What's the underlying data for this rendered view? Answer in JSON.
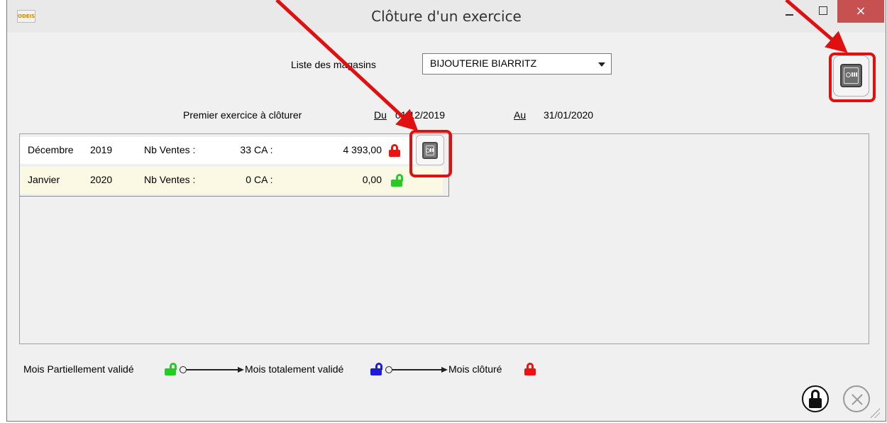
{
  "window": {
    "title": "Clôture d'un exercice",
    "logo_text": "ODEIS",
    "close_label": "×"
  },
  "store": {
    "label": "Liste des magasins",
    "selected": "BIJOUTERIE BIARRITZ"
  },
  "period": {
    "label": "Premier exercice à clôturer",
    "from_label": "Du",
    "from_value": "01/12/2019",
    "to_label": "Au",
    "to_value": "31/01/2020"
  },
  "months": [
    {
      "month": "Décembre",
      "year": "2019",
      "sales_label": "Nb Ventes :",
      "sales": "33",
      "ca_label": "CA :",
      "ca": "4 393,00",
      "status": "locked",
      "lock_color": "#ee1111"
    },
    {
      "month": "Janvier",
      "year": "2020",
      "sales_label": "Nb Ventes :",
      "sales": "0",
      "ca_label": "CA :",
      "ca": "0,00",
      "status": "partially-validated",
      "lock_color": "#22cc22"
    }
  ],
  "legend": {
    "partial": "Mois Partiellement validé",
    "total": "Mois totalement validé",
    "closed": "Mois clôturé",
    "colors": {
      "partial": "#22cc22",
      "total": "#1d1dd8",
      "closed": "#ee1111"
    }
  },
  "icons": {
    "safe": "safe-icon",
    "lock": "padlock-icon",
    "cancel": "cancel-icon"
  },
  "annotation_color": "#e01010"
}
